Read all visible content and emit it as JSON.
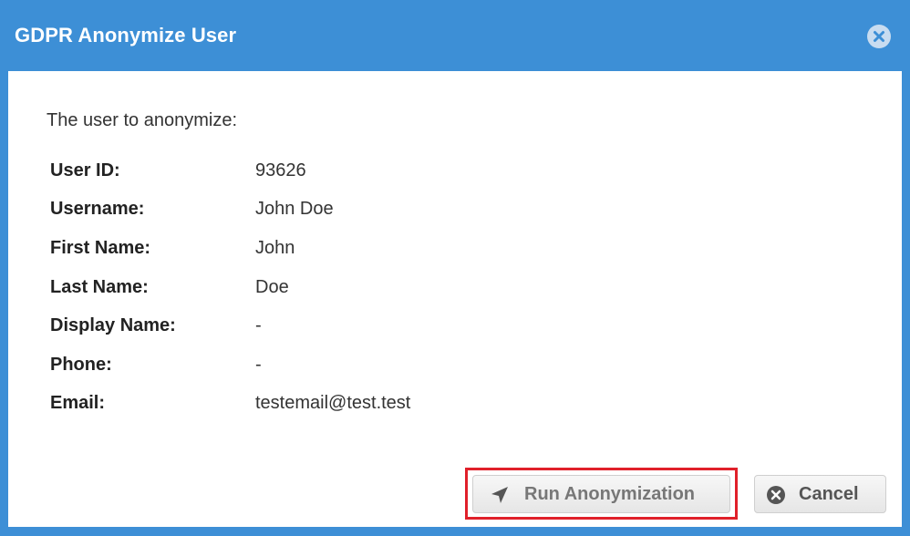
{
  "dialog": {
    "title": "GDPR Anonymize User",
    "intro": "The user to anonymize:",
    "fields": [
      {
        "label": "User ID:",
        "value": "93626"
      },
      {
        "label": "Username:",
        "value": "John Doe"
      },
      {
        "label": "First Name:",
        "value": "John"
      },
      {
        "label": "Last Name:",
        "value": "Doe"
      },
      {
        "label": "Display Name:",
        "value": "-"
      },
      {
        "label": "Phone:",
        "value": "-"
      },
      {
        "label": "Email:",
        "value": "testemail@test.test"
      }
    ],
    "buttons": {
      "run_label": "Run Anonymization",
      "cancel_label": "Cancel"
    }
  },
  "icons": {
    "close": "close-circle-icon",
    "run": "paper-plane-arrow-icon",
    "cancel": "close-circle-icon"
  },
  "colors": {
    "titlebar": "#3d8fd6",
    "highlight_border": "#e0202a",
    "button_text": "#555555"
  }
}
